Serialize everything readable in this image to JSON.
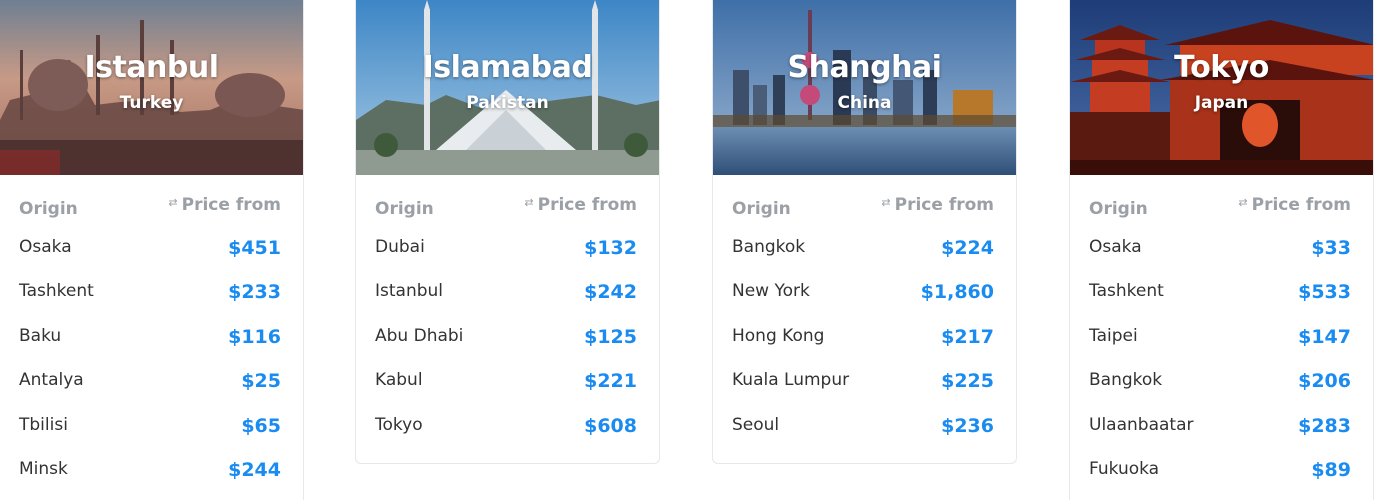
{
  "table_headers": {
    "origin": "Origin",
    "price": "Price from",
    "swap_icon": "swap-arrows-icon"
  },
  "colors": {
    "price": "#1a8bf0",
    "header": "#9aa0a6",
    "origin_text": "#333333"
  },
  "cards": [
    {
      "city": "Istanbul",
      "country": "Turkey",
      "rows": [
        {
          "origin": "Osaka",
          "price": "$451"
        },
        {
          "origin": "Tashkent",
          "price": "$233"
        },
        {
          "origin": "Baku",
          "price": "$116"
        },
        {
          "origin": "Antalya",
          "price": "$25"
        },
        {
          "origin": "Tbilisi",
          "price": "$65"
        },
        {
          "origin": "Minsk",
          "price": "$244"
        }
      ]
    },
    {
      "city": "Islamabad",
      "country": "Pakistan",
      "rows": [
        {
          "origin": "Dubai",
          "price": "$132"
        },
        {
          "origin": "Istanbul",
          "price": "$242"
        },
        {
          "origin": "Abu Dhabi",
          "price": "$125"
        },
        {
          "origin": "Kabul",
          "price": "$221"
        },
        {
          "origin": "Tokyo",
          "price": "$608"
        }
      ]
    },
    {
      "city": "Shanghai",
      "country": "China",
      "rows": [
        {
          "origin": "Bangkok",
          "price": "$224"
        },
        {
          "origin": "New York",
          "price": "$1,860"
        },
        {
          "origin": "Hong Kong",
          "price": "$217"
        },
        {
          "origin": "Kuala Lumpur",
          "price": "$225"
        },
        {
          "origin": "Seoul",
          "price": "$236"
        }
      ]
    },
    {
      "city": "Tokyo",
      "country": "Japan",
      "rows": [
        {
          "origin": "Osaka",
          "price": "$33"
        },
        {
          "origin": "Tashkent",
          "price": "$533"
        },
        {
          "origin": "Taipei",
          "price": "$147"
        },
        {
          "origin": "Bangkok",
          "price": "$206"
        },
        {
          "origin": "Ulaanbaatar",
          "price": "$283"
        },
        {
          "origin": "Fukuoka",
          "price": "$89"
        }
      ]
    }
  ]
}
